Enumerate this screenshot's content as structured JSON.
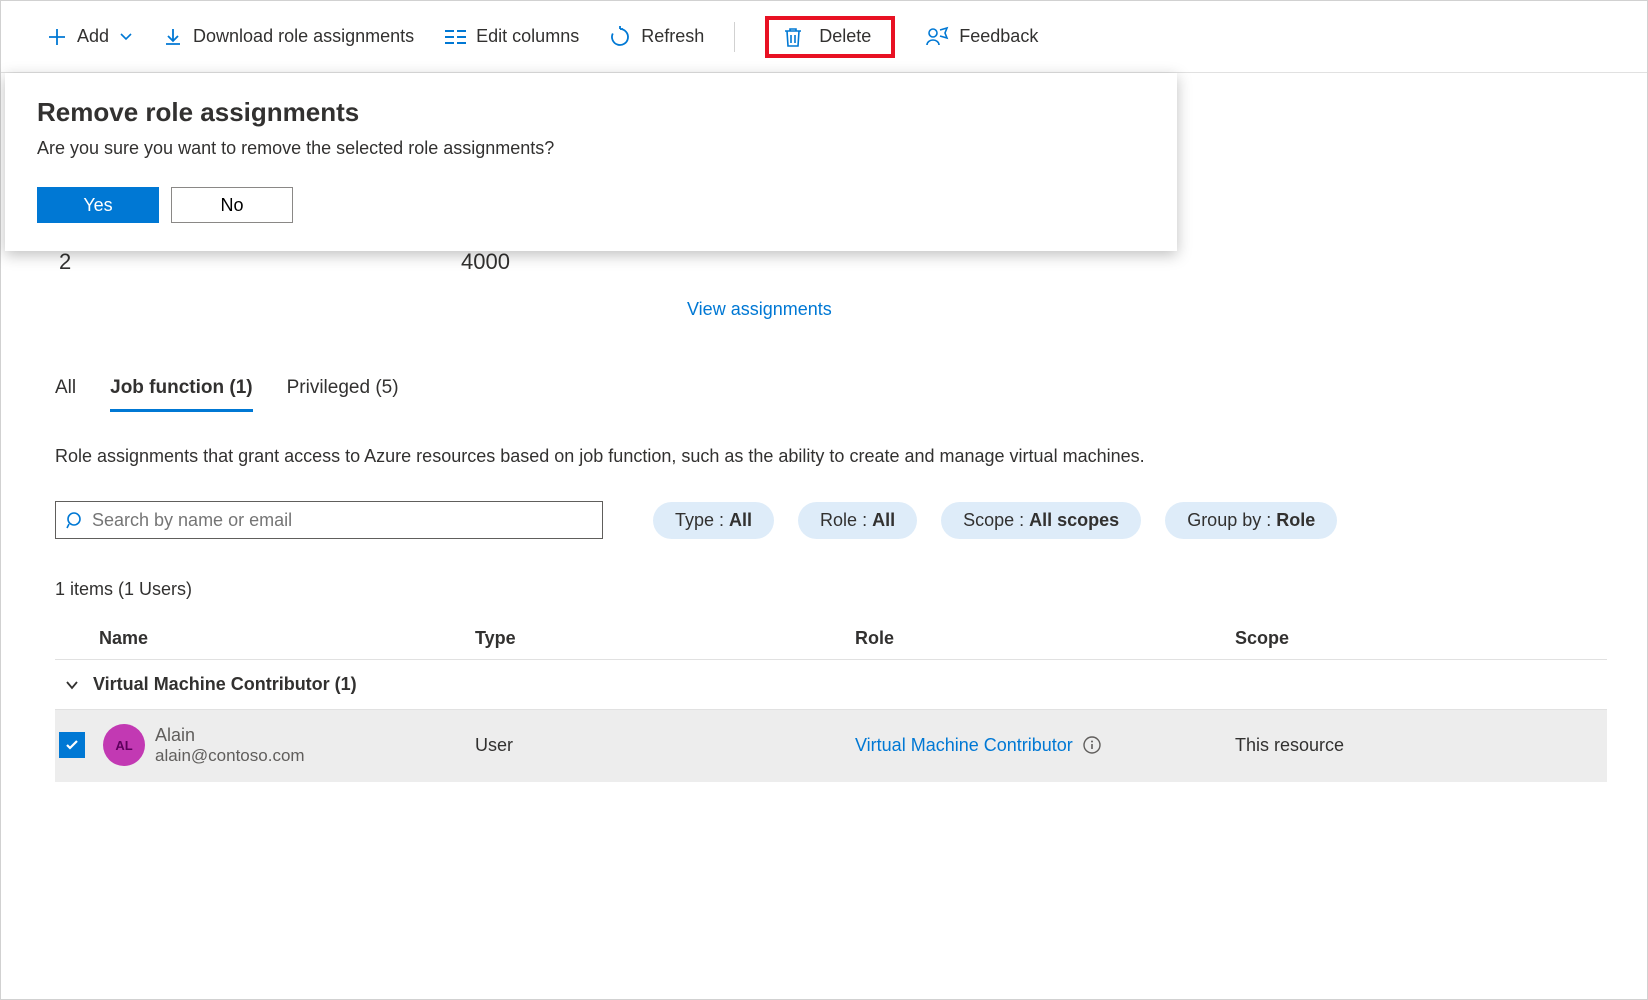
{
  "toolbar": {
    "add": "Add",
    "download": "Download role assignments",
    "edit_columns": "Edit columns",
    "refresh": "Refresh",
    "delete": "Delete",
    "feedback": "Feedback"
  },
  "dialog": {
    "title": "Remove role assignments",
    "message": "Are you sure you want to remove the selected role assignments?",
    "yes": "Yes",
    "no": "No"
  },
  "background": {
    "num1": "2",
    "num2": "4000",
    "view_assignments": "View assignments"
  },
  "tabs": {
    "all": "All",
    "job_function": "Job function (1)",
    "privileged": "Privileged (5)"
  },
  "description": "Role assignments that grant access to Azure resources based on job function, such as the ability to create and manage virtual machines.",
  "search": {
    "placeholder": "Search by name or email"
  },
  "filters": {
    "type_label": "Type : ",
    "type_value": "All",
    "role_label": "Role : ",
    "role_value": "All",
    "scope_label": "Scope : ",
    "scope_value": "All scopes",
    "group_label": "Group by : ",
    "group_value": "Role"
  },
  "count_line": "1 items (1 Users)",
  "columns": {
    "name": "Name",
    "type": "Type",
    "role": "Role",
    "scope": "Scope"
  },
  "group": {
    "title": "Virtual Machine Contributor (1)"
  },
  "row": {
    "avatar_initials": "AL",
    "name": "Alain",
    "email": "alain@contoso.com",
    "type": "User",
    "role": "Virtual Machine Contributor",
    "scope": "This resource"
  }
}
